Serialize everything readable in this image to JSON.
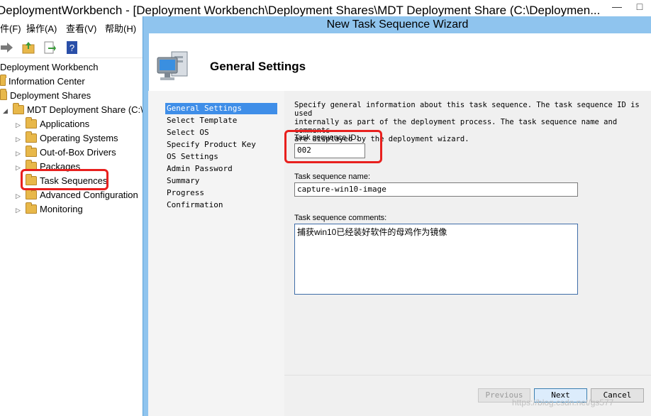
{
  "mmc": {
    "title": "DeploymentWorkbench - [Deployment Workbench\\Deployment Shares\\MDT Deployment Share (C:\\Deploymen...",
    "window_controls": [
      "—",
      "□"
    ],
    "menu": [
      "件(F)",
      "操作(A)",
      "查看(V)",
      "帮助(H)"
    ],
    "tree": {
      "root": "Deployment Workbench",
      "info_center": "Information Center",
      "shares": "Deployment Shares",
      "share": "MDT Deployment Share (C:\\",
      "items": [
        "Applications",
        "Operating Systems",
        "Out-of-Box Drivers",
        "Packages",
        "Task Sequences",
        "Advanced Configuration",
        "Monitoring"
      ]
    }
  },
  "wizard": {
    "title": "New Task Sequence Wizard",
    "heading": "General Settings",
    "nav": [
      "General Settings",
      "Select Template",
      "Select OS",
      "Specify Product Key",
      "OS Settings",
      "Admin Password",
      "Summary",
      "Progress",
      "Confirmation"
    ],
    "description_lines": [
      "Specify general information about this task sequence.  The task sequence ID is used",
      "internally as part of the deployment process.  The task sequence name and comments",
      "are displayed by the deployment wizard."
    ],
    "id_label": "Task sequence ID:",
    "id_value": "002",
    "name_label": "Task sequence name:",
    "name_value": "capture-win10-image",
    "comments_label": "Task sequence comments:",
    "comments_value": "捕获win10已经装好软件的母鸡作为镜像",
    "buttons": {
      "previous": "Previous",
      "next": "Next",
      "cancel": "Cancel"
    },
    "watermark": "https://blog.csdn.net/gs577"
  },
  "colors": {
    "highlight": "#e8201e",
    "titlebar": "#8fc4ee",
    "nav_active": "#3f8ee8"
  }
}
